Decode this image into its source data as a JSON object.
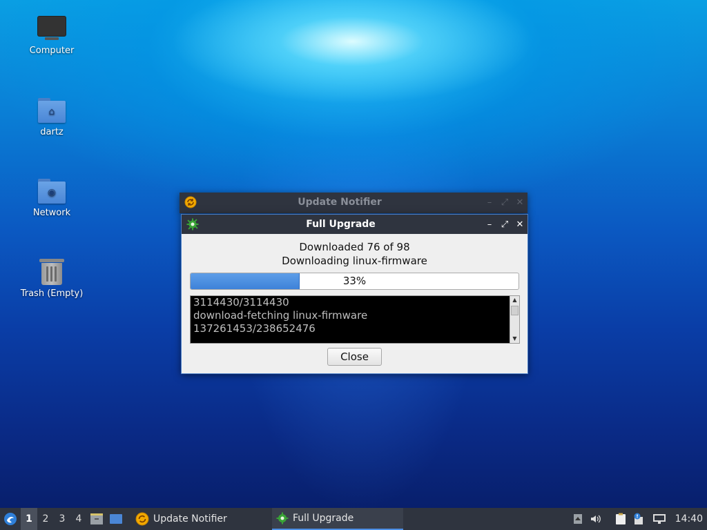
{
  "desktop": {
    "icons": [
      {
        "label": "Computer",
        "icon": "computer-icon"
      },
      {
        "label": "dartz",
        "icon": "home-folder-icon"
      },
      {
        "label": "Network",
        "icon": "network-folder-icon"
      },
      {
        "label": "Trash (Empty)",
        "icon": "trash-icon"
      }
    ]
  },
  "windows": {
    "notifier": {
      "title": "Update Notifier",
      "icon": "update-notifier-icon"
    },
    "upgrade": {
      "title": "Full Upgrade",
      "icon": "gear-icon",
      "status": "Downloaded 76 of 98",
      "current": "Downloading linux-firmware",
      "progress_percent": 33,
      "progress_label": "33%",
      "log_lines": [
        "3114430/3114430",
        "download-fetching linux-firmware",
        "137261453/238652476"
      ],
      "close_label": "Close"
    }
  },
  "taskbar": {
    "desktops": [
      "1",
      "2",
      "3",
      "4"
    ],
    "active_desktop": "1",
    "tasks": [
      {
        "label": "Update Notifier",
        "icon": "update-notifier-icon"
      },
      {
        "label": "Full Upgrade",
        "icon": "gear-icon"
      }
    ],
    "clock": "14:40"
  },
  "colors": {
    "panel": "#2f343f",
    "accent": "#4c8fe6",
    "progress_fill": "#3e82d9",
    "notifier_icon": "#f2a900",
    "gear_icon": "#39a336"
  }
}
